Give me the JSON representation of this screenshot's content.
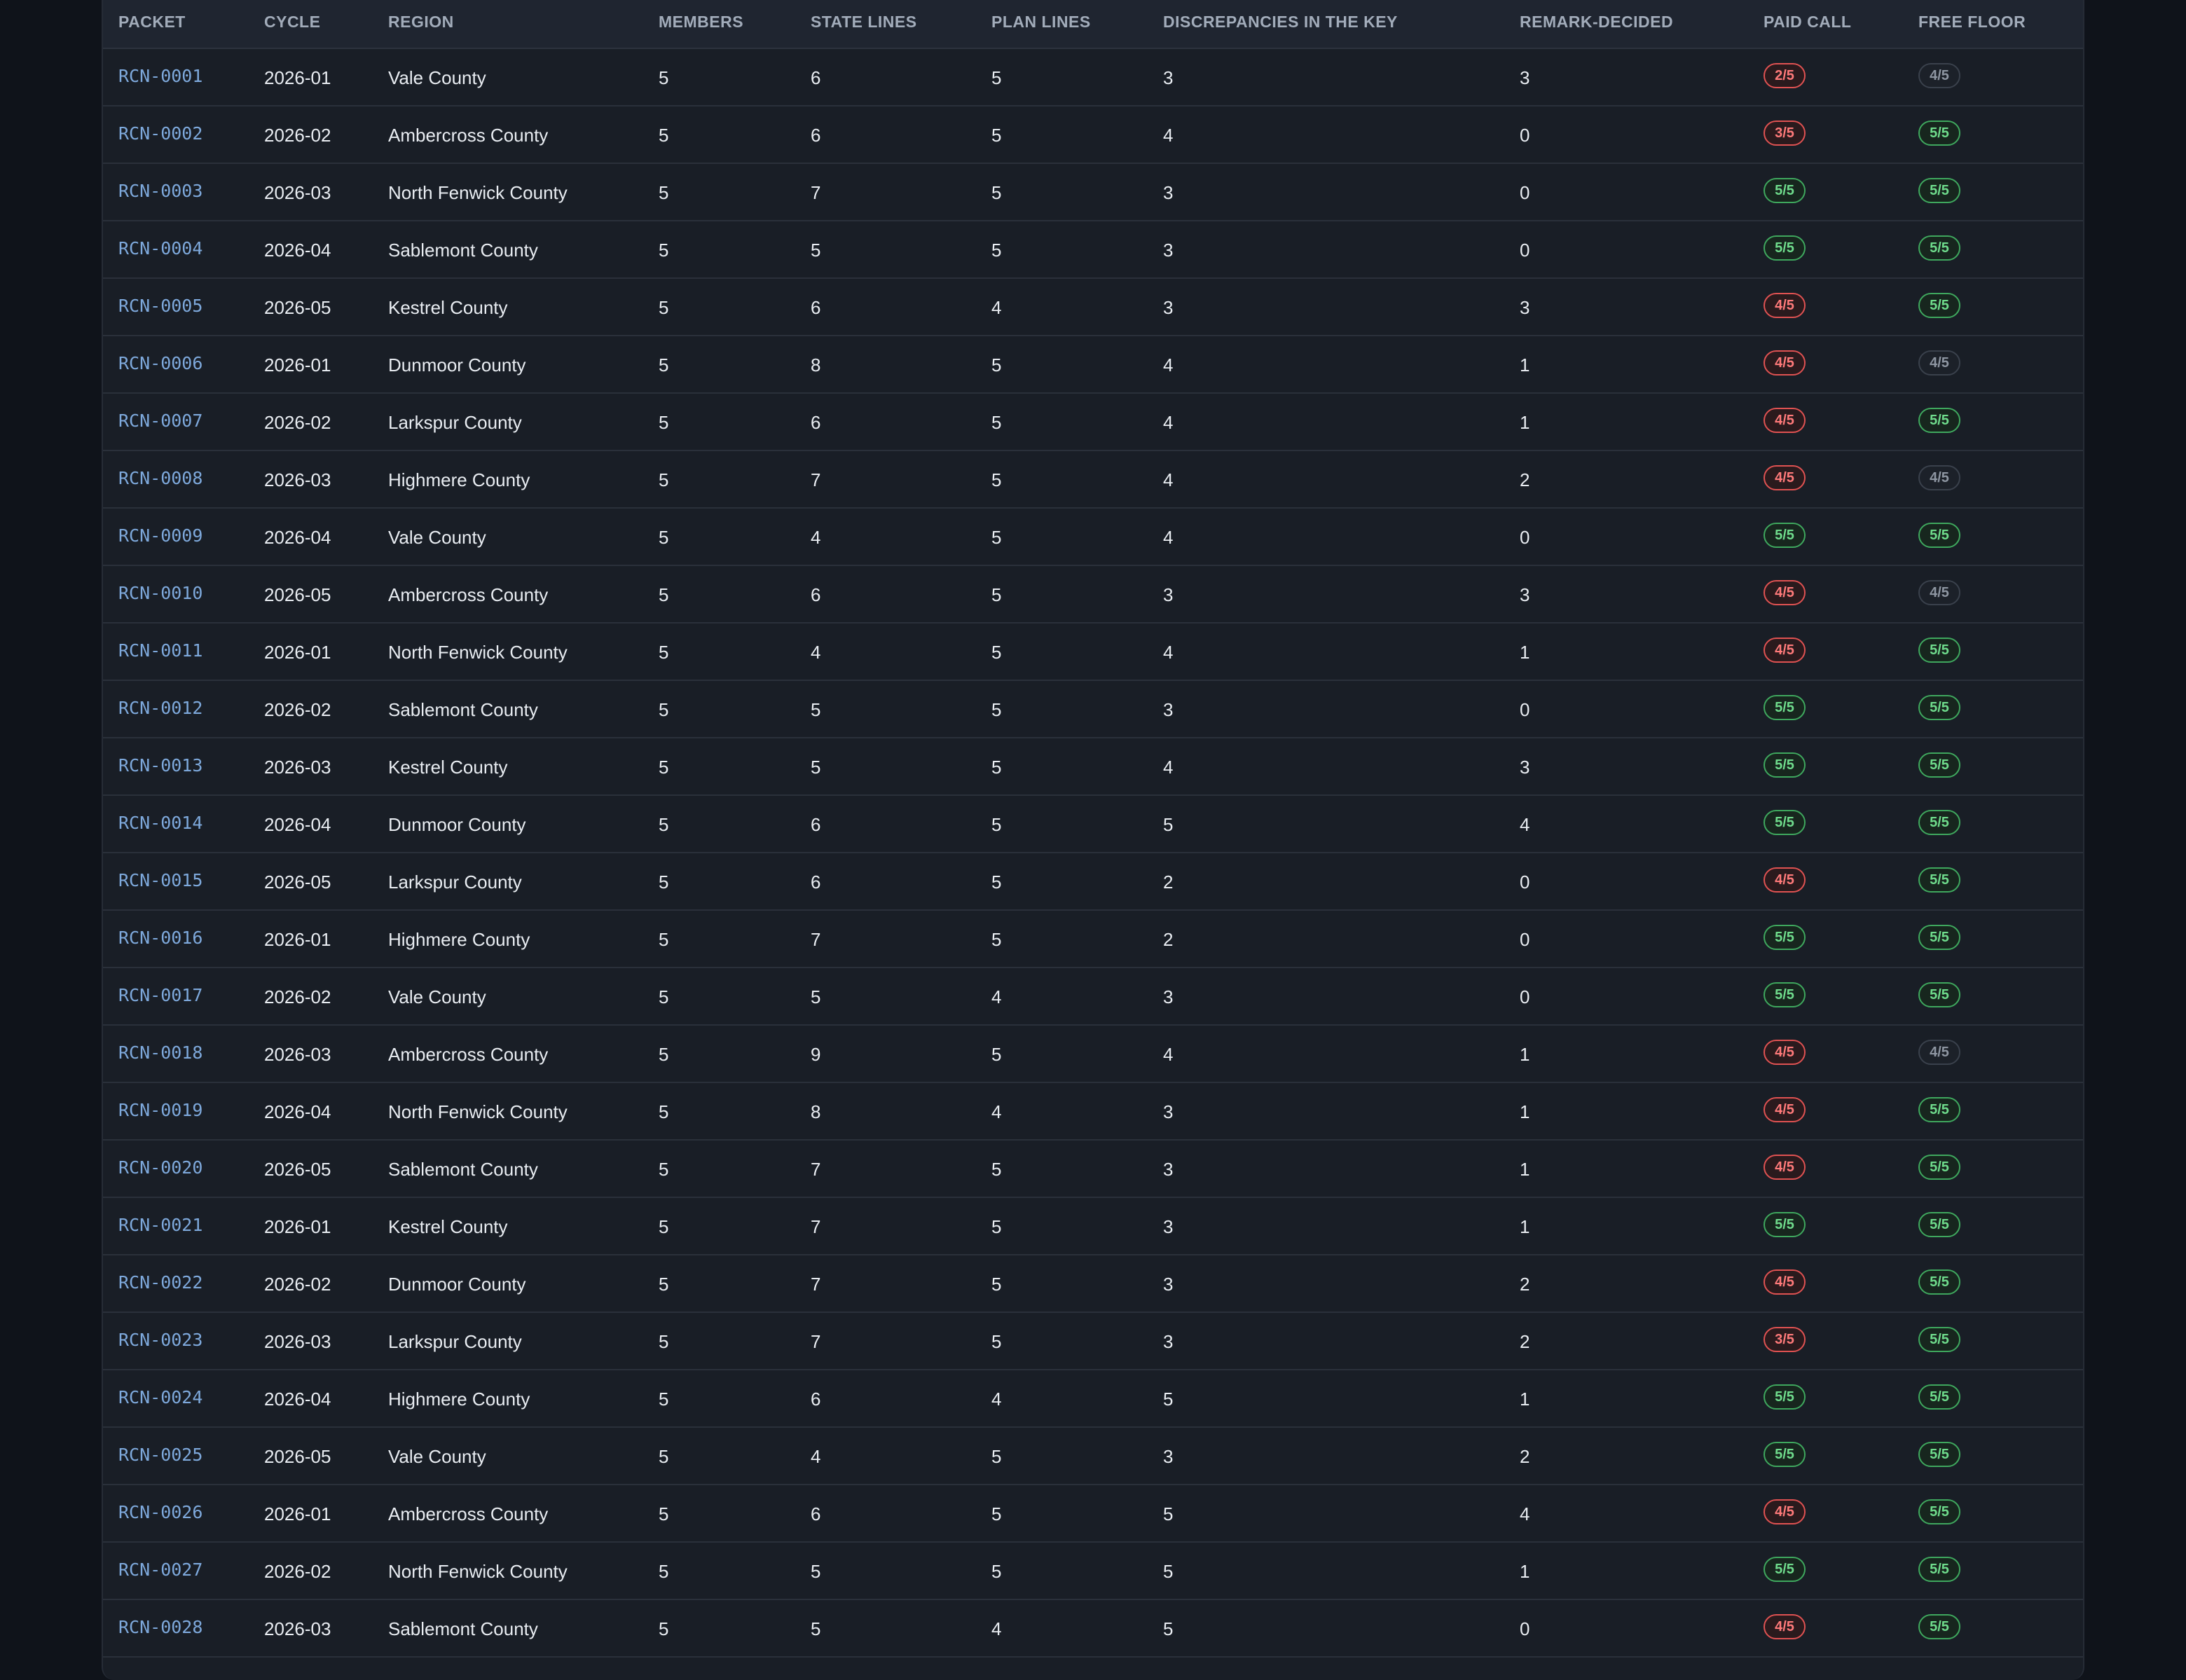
{
  "table": {
    "columns": [
      "PACKET",
      "CYCLE",
      "REGION",
      "MEMBERS",
      "STATE LINES",
      "PLAN LINES",
      "DISCREPANCIES IN THE KEY",
      "REMARK-DECIDED",
      "PAID CALL",
      "FREE FLOOR"
    ],
    "rows": [
      {
        "packet": "RCN-0001",
        "cycle": "2026-01",
        "region": "Vale County",
        "members": "5",
        "state_lines": "6",
        "plan_lines": "5",
        "discrepancies": "3",
        "remark_decided": "3",
        "paid_call": "2/5",
        "paid_status": "red",
        "free_floor": "4/5",
        "free_status": "gray"
      },
      {
        "packet": "RCN-0002",
        "cycle": "2026-02",
        "region": "Ambercross County",
        "members": "5",
        "state_lines": "6",
        "plan_lines": "5",
        "discrepancies": "4",
        "remark_decided": "0",
        "paid_call": "3/5",
        "paid_status": "red",
        "free_floor": "5/5",
        "free_status": "green"
      },
      {
        "packet": "RCN-0003",
        "cycle": "2026-03",
        "region": "North Fenwick County",
        "members": "5",
        "state_lines": "7",
        "plan_lines": "5",
        "discrepancies": "3",
        "remark_decided": "0",
        "paid_call": "5/5",
        "paid_status": "green",
        "free_floor": "5/5",
        "free_status": "green"
      },
      {
        "packet": "RCN-0004",
        "cycle": "2026-04",
        "region": "Sablemont County",
        "members": "5",
        "state_lines": "5",
        "plan_lines": "5",
        "discrepancies": "3",
        "remark_decided": "0",
        "paid_call": "5/5",
        "paid_status": "green",
        "free_floor": "5/5",
        "free_status": "green"
      },
      {
        "packet": "RCN-0005",
        "cycle": "2026-05",
        "region": "Kestrel County",
        "members": "5",
        "state_lines": "6",
        "plan_lines": "4",
        "discrepancies": "3",
        "remark_decided": "3",
        "paid_call": "4/5",
        "paid_status": "red",
        "free_floor": "5/5",
        "free_status": "green"
      },
      {
        "packet": "RCN-0006",
        "cycle": "2026-01",
        "region": "Dunmoor County",
        "members": "5",
        "state_lines": "8",
        "plan_lines": "5",
        "discrepancies": "4",
        "remark_decided": "1",
        "paid_call": "4/5",
        "paid_status": "red",
        "free_floor": "4/5",
        "free_status": "gray"
      },
      {
        "packet": "RCN-0007",
        "cycle": "2026-02",
        "region": "Larkspur County",
        "members": "5",
        "state_lines": "6",
        "plan_lines": "5",
        "discrepancies": "4",
        "remark_decided": "1",
        "paid_call": "4/5",
        "paid_status": "red",
        "free_floor": "5/5",
        "free_status": "green"
      },
      {
        "packet": "RCN-0008",
        "cycle": "2026-03",
        "region": "Highmere County",
        "members": "5",
        "state_lines": "7",
        "plan_lines": "5",
        "discrepancies": "4",
        "remark_decided": "2",
        "paid_call": "4/5",
        "paid_status": "red",
        "free_floor": "4/5",
        "free_status": "gray"
      },
      {
        "packet": "RCN-0009",
        "cycle": "2026-04",
        "region": "Vale County",
        "members": "5",
        "state_lines": "4",
        "plan_lines": "5",
        "discrepancies": "4",
        "remark_decided": "0",
        "paid_call": "5/5",
        "paid_status": "green",
        "free_floor": "5/5",
        "free_status": "green"
      },
      {
        "packet": "RCN-0010",
        "cycle": "2026-05",
        "region": "Ambercross County",
        "members": "5",
        "state_lines": "6",
        "plan_lines": "5",
        "discrepancies": "3",
        "remark_decided": "3",
        "paid_call": "4/5",
        "paid_status": "red",
        "free_floor": "4/5",
        "free_status": "gray"
      },
      {
        "packet": "RCN-0011",
        "cycle": "2026-01",
        "region": "North Fenwick County",
        "members": "5",
        "state_lines": "4",
        "plan_lines": "5",
        "discrepancies": "4",
        "remark_decided": "1",
        "paid_call": "4/5",
        "paid_status": "red",
        "free_floor": "5/5",
        "free_status": "green"
      },
      {
        "packet": "RCN-0012",
        "cycle": "2026-02",
        "region": "Sablemont County",
        "members": "5",
        "state_lines": "5",
        "plan_lines": "5",
        "discrepancies": "3",
        "remark_decided": "0",
        "paid_call": "5/5",
        "paid_status": "green",
        "free_floor": "5/5",
        "free_status": "green"
      },
      {
        "packet": "RCN-0013",
        "cycle": "2026-03",
        "region": "Kestrel County",
        "members": "5",
        "state_lines": "5",
        "plan_lines": "5",
        "discrepancies": "4",
        "remark_decided": "3",
        "paid_call": "5/5",
        "paid_status": "green",
        "free_floor": "5/5",
        "free_status": "green"
      },
      {
        "packet": "RCN-0014",
        "cycle": "2026-04",
        "region": "Dunmoor County",
        "members": "5",
        "state_lines": "6",
        "plan_lines": "5",
        "discrepancies": "5",
        "remark_decided": "4",
        "paid_call": "5/5",
        "paid_status": "green",
        "free_floor": "5/5",
        "free_status": "green"
      },
      {
        "packet": "RCN-0015",
        "cycle": "2026-05",
        "region": "Larkspur County",
        "members": "5",
        "state_lines": "6",
        "plan_lines": "5",
        "discrepancies": "2",
        "remark_decided": "0",
        "paid_call": "4/5",
        "paid_status": "red",
        "free_floor": "5/5",
        "free_status": "green"
      },
      {
        "packet": "RCN-0016",
        "cycle": "2026-01",
        "region": "Highmere County",
        "members": "5",
        "state_lines": "7",
        "plan_lines": "5",
        "discrepancies": "2",
        "remark_decided": "0",
        "paid_call": "5/5",
        "paid_status": "green",
        "free_floor": "5/5",
        "free_status": "green"
      },
      {
        "packet": "RCN-0017",
        "cycle": "2026-02",
        "region": "Vale County",
        "members": "5",
        "state_lines": "5",
        "plan_lines": "4",
        "discrepancies": "3",
        "remark_decided": "0",
        "paid_call": "5/5",
        "paid_status": "green",
        "free_floor": "5/5",
        "free_status": "green"
      },
      {
        "packet": "RCN-0018",
        "cycle": "2026-03",
        "region": "Ambercross County",
        "members": "5",
        "state_lines": "9",
        "plan_lines": "5",
        "discrepancies": "4",
        "remark_decided": "1",
        "paid_call": "4/5",
        "paid_status": "red",
        "free_floor": "4/5",
        "free_status": "gray"
      },
      {
        "packet": "RCN-0019",
        "cycle": "2026-04",
        "region": "North Fenwick County",
        "members": "5",
        "state_lines": "8",
        "plan_lines": "4",
        "discrepancies": "3",
        "remark_decided": "1",
        "paid_call": "4/5",
        "paid_status": "red",
        "free_floor": "5/5",
        "free_status": "green"
      },
      {
        "packet": "RCN-0020",
        "cycle": "2026-05",
        "region": "Sablemont County",
        "members": "5",
        "state_lines": "7",
        "plan_lines": "5",
        "discrepancies": "3",
        "remark_decided": "1",
        "paid_call": "4/5",
        "paid_status": "red",
        "free_floor": "5/5",
        "free_status": "green"
      },
      {
        "packet": "RCN-0021",
        "cycle": "2026-01",
        "region": "Kestrel County",
        "members": "5",
        "state_lines": "7",
        "plan_lines": "5",
        "discrepancies": "3",
        "remark_decided": "1",
        "paid_call": "5/5",
        "paid_status": "green",
        "free_floor": "5/5",
        "free_status": "green"
      },
      {
        "packet": "RCN-0022",
        "cycle": "2026-02",
        "region": "Dunmoor County",
        "members": "5",
        "state_lines": "7",
        "plan_lines": "5",
        "discrepancies": "3",
        "remark_decided": "2",
        "paid_call": "4/5",
        "paid_status": "red",
        "free_floor": "5/5",
        "free_status": "green"
      },
      {
        "packet": "RCN-0023",
        "cycle": "2026-03",
        "region": "Larkspur County",
        "members": "5",
        "state_lines": "7",
        "plan_lines": "5",
        "discrepancies": "3",
        "remark_decided": "2",
        "paid_call": "3/5",
        "paid_status": "red",
        "free_floor": "5/5",
        "free_status": "green"
      },
      {
        "packet": "RCN-0024",
        "cycle": "2026-04",
        "region": "Highmere County",
        "members": "5",
        "state_lines": "6",
        "plan_lines": "4",
        "discrepancies": "5",
        "remark_decided": "1",
        "paid_call": "5/5",
        "paid_status": "green",
        "free_floor": "5/5",
        "free_status": "green"
      },
      {
        "packet": "RCN-0025",
        "cycle": "2026-05",
        "region": "Vale County",
        "members": "5",
        "state_lines": "4",
        "plan_lines": "5",
        "discrepancies": "3",
        "remark_decided": "2",
        "paid_call": "5/5",
        "paid_status": "green",
        "free_floor": "5/5",
        "free_status": "green"
      },
      {
        "packet": "RCN-0026",
        "cycle": "2026-01",
        "region": "Ambercross County",
        "members": "5",
        "state_lines": "6",
        "plan_lines": "5",
        "discrepancies": "5",
        "remark_decided": "4",
        "paid_call": "4/5",
        "paid_status": "red",
        "free_floor": "5/5",
        "free_status": "green"
      },
      {
        "packet": "RCN-0027",
        "cycle": "2026-02",
        "region": "North Fenwick County",
        "members": "5",
        "state_lines": "5",
        "plan_lines": "5",
        "discrepancies": "5",
        "remark_decided": "1",
        "paid_call": "5/5",
        "paid_status": "green",
        "free_floor": "5/5",
        "free_status": "green"
      },
      {
        "packet": "RCN-0028",
        "cycle": "2026-03",
        "region": "Sablemont County",
        "members": "5",
        "state_lines": "5",
        "plan_lines": "4",
        "discrepancies": "5",
        "remark_decided": "0",
        "paid_call": "4/5",
        "paid_status": "red",
        "free_floor": "5/5",
        "free_status": "green"
      }
    ]
  }
}
